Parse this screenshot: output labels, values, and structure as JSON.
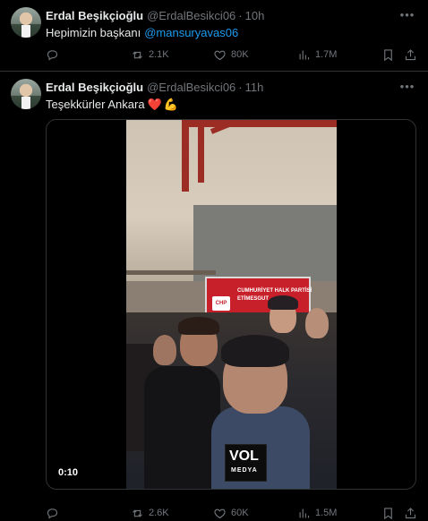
{
  "tweets": [
    {
      "author": {
        "name": "Erdal Beşikçioğlu",
        "handle": "@ErdalBesikci06"
      },
      "separator": "·",
      "time": "10h",
      "text": "Hepimizin başkanı",
      "mention": "@mansuryavas06",
      "actions": {
        "replies": "",
        "retweets": "2.1K",
        "likes": "80K",
        "views": "1.7M"
      }
    },
    {
      "author": {
        "name": "Erdal Beşikçioğlu",
        "handle": "@ErdalBesikci06"
      },
      "separator": "·",
      "time": "11h",
      "text": "Teşekkürler Ankara",
      "emoji": [
        "❤️",
        "💪"
      ],
      "media": {
        "type": "video",
        "duration": "0:10",
        "watermark": {
          "line1": "VOL",
          "line2": "MEDYA"
        },
        "sign_text": [
          "CUMHURİYET HALK PARTİSİ",
          "ETİMESGUT"
        ],
        "sign_logo": "CHP"
      },
      "actions": {
        "replies": "",
        "retweets": "2.6K",
        "likes": "60K",
        "views": "1.5M"
      }
    }
  ],
  "icons": {
    "more": "more-horizontal-icon",
    "reply": "reply-icon",
    "retweet": "retweet-icon",
    "like": "heart-icon",
    "views": "views-bar-chart-icon",
    "bookmark": "bookmark-icon",
    "share": "share-icon"
  },
  "colors": {
    "background": "#000000",
    "text": "#e7e9ea",
    "muted": "#71767b",
    "link": "#1d9bf0",
    "border": "#2f3336"
  }
}
